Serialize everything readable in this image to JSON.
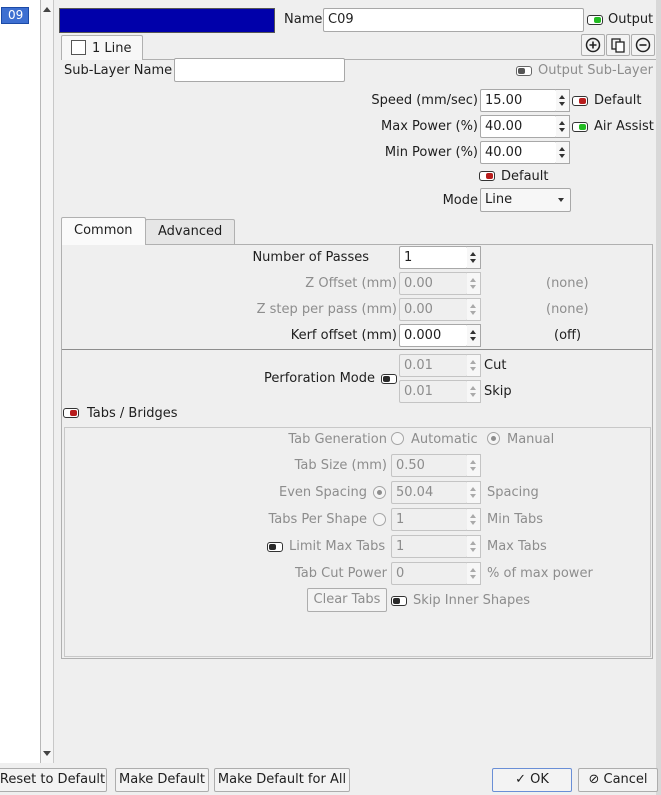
{
  "layer_list": {
    "selected_item": "09"
  },
  "header": {
    "layer_color": "#0000aa",
    "name_label": "Name",
    "name_value": "C09",
    "output_label": "Output"
  },
  "sublayer_tab": {
    "label": "1 Line"
  },
  "sublayer": {
    "name_label": "Sub-Layer Name",
    "name_value": "",
    "output_label": "Output Sub-Layer"
  },
  "params": {
    "speed_label": "Speed (mm/sec)",
    "speed_value": "15.00",
    "speed_default_label": "Default",
    "max_power_label": "Max Power (%)",
    "max_power_value": "40.00",
    "air_assist_label": "Air Assist",
    "min_power_label": "Min Power (%)",
    "min_power_value": "40.00",
    "default_label": "Default",
    "mode_label": "Mode",
    "mode_value": "Line"
  },
  "tabs": {
    "common": "Common",
    "advanced": "Advanced"
  },
  "common": {
    "passes_label": "Number of Passes",
    "passes_value": "1",
    "z_offset_label": "Z Offset (mm)",
    "z_offset_value": "0.00",
    "z_offset_note": "(none)",
    "z_step_label": "Z step per pass (mm)",
    "z_step_value": "0.00",
    "z_step_note": "(none)",
    "kerf_label": "Kerf offset (mm)",
    "kerf_value": "0.000",
    "kerf_note": "(off)",
    "perf_label": "Perforation Mode",
    "perf_cut_value": "0.01",
    "perf_cut_label": "Cut",
    "perf_skip_value": "0.01",
    "perf_skip_label": "Skip"
  },
  "tabs_bridges": {
    "label": "Tabs / Bridges",
    "generation_label": "Tab Generation",
    "automatic_label": "Automatic",
    "manual_label": "Manual",
    "size_label": "Tab Size (mm)",
    "size_value": "0.50",
    "even_spacing_label": "Even Spacing",
    "even_spacing_value": "50.04",
    "spacing_label": "Spacing",
    "per_shape_label": "Tabs Per Shape",
    "per_shape_value": "1",
    "min_tabs_label": "Min Tabs",
    "limit_max_label": "Limit Max Tabs",
    "limit_max_value": "1",
    "max_tabs_label": "Max Tabs",
    "cut_power_label": "Tab Cut Power",
    "cut_power_value": "0",
    "cut_power_unit": "% of max power",
    "clear_tabs_label": "Clear Tabs",
    "skip_inner_label": "Skip Inner Shapes"
  },
  "footer": {
    "reset_label": "Reset to Default",
    "make_default_label": "Make Default",
    "make_default_all_label": "Make Default for All",
    "ok_label": "OK",
    "cancel_label": "Cancel"
  }
}
